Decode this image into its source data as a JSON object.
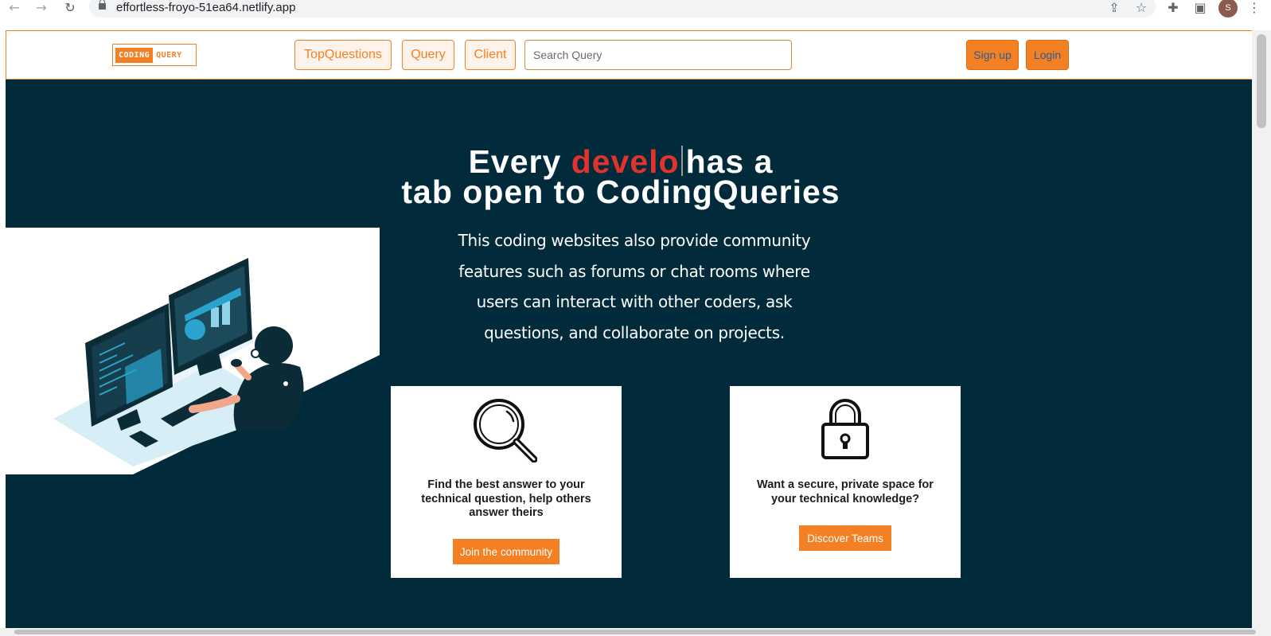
{
  "browser": {
    "url": "effortless-froyo-51ea64.netlify.app",
    "avatar_letter": "S",
    "icons": [
      "back-arrow-icon",
      "forward-arrow-icon",
      "reload-icon",
      "lock-icon",
      "share-icon",
      "star-icon",
      "extensions-icon",
      "side-panel-icon",
      "menu-icon"
    ]
  },
  "header": {
    "logo": {
      "part1": "CODING",
      "part2": "QUERY"
    },
    "nav": [
      "TopQuestions",
      "Query",
      "Client"
    ],
    "search_placeholder": "Search Query",
    "signup_label": "Sign up",
    "login_label": "Login"
  },
  "hero": {
    "title_line1_before": "Every",
    "title_typed": "develo",
    "title_line1_after": "has a",
    "title_line2": "tab open to CodingQueries",
    "description": "This coding websites also provide community features such as forums or chat rooms where users can interact with other coders, ask questions, and collaborate on projects."
  },
  "cards": [
    {
      "icon": "magnifier-icon",
      "text": "Find the best answer to your technical question, help others answer theirs",
      "button": "Join the community"
    },
    {
      "icon": "padlock-icon",
      "text": "Want a secure, private space for your technical knowledge?",
      "button": "Discover Teams"
    }
  ],
  "colors": {
    "accent": "#f48024",
    "hero_bg": "#012b3b",
    "typed_text": "#e0332e"
  }
}
